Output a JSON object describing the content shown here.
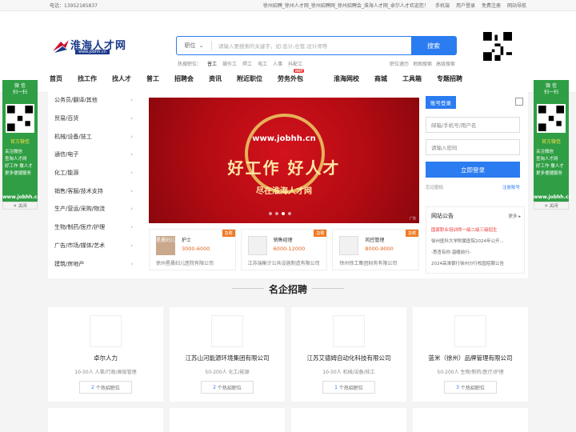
{
  "topbar": {
    "phone": "电话：13952185837",
    "slogan": "徐州招聘_徐州人才网_徐州招聘网_徐州招聘会_淮海人才网_卓尔人才欢迎您！",
    "links": [
      "手机端",
      "用户登录",
      "免费注册",
      "网站导航"
    ]
  },
  "logo": {
    "text": "淮海人才网",
    "url": "www.jobhh.cn"
  },
  "search": {
    "scope": "职位",
    "placeholder": "请输入要搜索的关键字，如:会计,仓管,设计师等",
    "button": "搜索"
  },
  "hot": {
    "label": "热搜职位：",
    "items": [
      "普工",
      "操作工",
      "焊工",
      "电工",
      "人事",
      "抖配工"
    ]
  },
  "search_links": [
    "职位速历",
    "地图搜索",
    "高级搜索"
  ],
  "nav": [
    "首页",
    "找工作",
    "找人才",
    "普工",
    "招聘会",
    "资讯",
    "附近职位",
    "劳务外包",
    "淮海网校",
    "商城",
    "工具箱",
    "专题招聘"
  ],
  "nav_hot": "HOT",
  "categories": [
    "公务员/翻译/其他",
    "贸易/百货",
    "机械/设备/技工",
    "通信/电子",
    "化工/能源",
    "销售/客服/技术支持",
    "生产/营运/采购/物流",
    "生物/制药/医疗/护理",
    "广告/市场/媒体/艺术",
    "建筑/房地产"
  ],
  "banner": {
    "url": "www.jobhh.cn",
    "slogan": "好工作  好人才",
    "sub": "尽在淮海人才网",
    "ad": "广告"
  },
  "featured_jobs": [
    {
      "title": "护士",
      "salary": "3000-6000",
      "company": "徐州星晨妇儿医院有限公司",
      "tag": "急聘",
      "logo_text": "星晨妇儿"
    },
    {
      "title": "销售经理",
      "salary": "6000-12000",
      "company": "江苏瑞衡计公共设施制造有限公司",
      "tag": "急聘",
      "logo_text": ""
    },
    {
      "title": "风控管理",
      "salary": "8000-9000",
      "company": "徐州徐工集团财务有限公司",
      "tag": "急聘",
      "logo_text": ""
    }
  ],
  "login": {
    "tab": "账号登录",
    "user_placeholder": "邮箱/手机号/用户名",
    "pwd_placeholder": "请输入密码",
    "button": "立即登录",
    "forgot": "忘记密码",
    "register": "注册账号"
  },
  "notice": {
    "title": "网站公告",
    "more": "更多 ▸",
    "items": [
      "国家职业培训师一级二级三级招生",
      "徐州医科大学附属医院2024年公开...",
      "-悉查有你·温暖前行-",
      "2024高淮银行徐州分行校园招聘公告"
    ]
  },
  "section_title": "名企招聘",
  "companies": [
    {
      "name": "卓尔人力",
      "desc": "10-50人  人事/行政/高级管理",
      "jobs": "2",
      "jobs_label": "个热招职位"
    },
    {
      "name": "江苏山河能源环境集团有限公司",
      "desc": "50-200人  化工/能源",
      "jobs": "2",
      "jobs_label": "个热招职位"
    },
    {
      "name": "江苏艾德姆自动化科技有限公司",
      "desc": "10-50人  机械/设备/技工",
      "jobs": "1",
      "jobs_label": "个热招职位"
    },
    {
      "name": "蓝米（徐州）品牌管理有限公司",
      "desc": "50-200人  生物/制药/医疗/护理",
      "jobs": "3",
      "jobs_label": "个热招职位"
    }
  ],
  "side": {
    "wechat": "微 信\n扫一扫",
    "label": "官方微信",
    "lines": [
      "关注微信",
      "查淘人才网",
      "好工作 撒人才",
      "更多便捷服务"
    ],
    "url": "www.jobhh.cn",
    "close": "✕ 关闭"
  }
}
